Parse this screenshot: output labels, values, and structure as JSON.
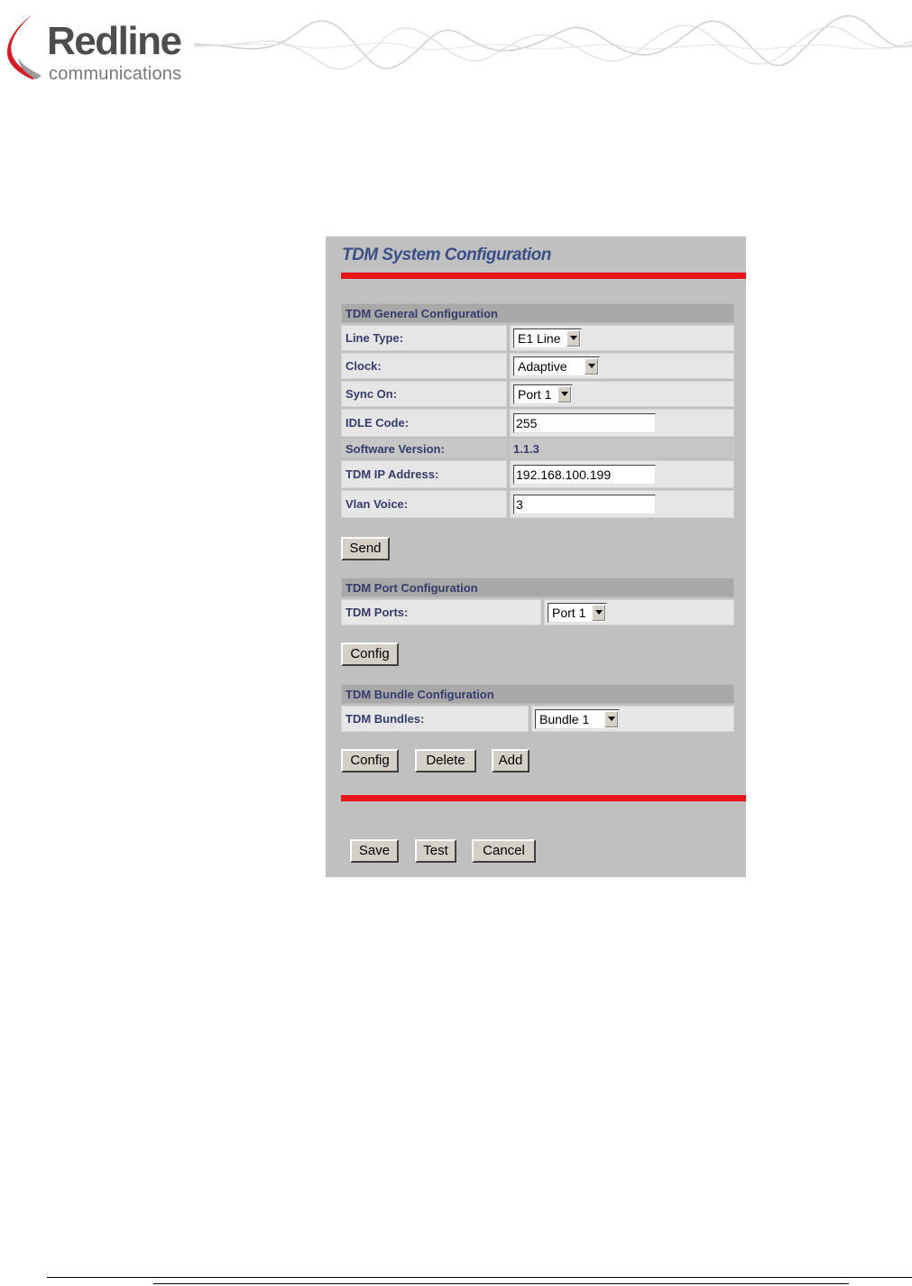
{
  "brand": {
    "name": "Redline",
    "tagline": "communications"
  },
  "panel": {
    "title": "TDM System Configuration",
    "general": {
      "header": "TDM General Configuration",
      "line_type": {
        "label": "Line Type:",
        "value": "E1 Line"
      },
      "clock": {
        "label": "Clock:",
        "value": "Adaptive"
      },
      "sync_on": {
        "label": "Sync On:",
        "value": "Port 1"
      },
      "idle_code": {
        "label": "IDLE Code:",
        "value": "255"
      },
      "software_version": {
        "label": "Software Version:",
        "value": "1.1.3"
      },
      "tdm_ip": {
        "label": "TDM IP Address:",
        "value": "192.168.100.199"
      },
      "vlan_voice": {
        "label": "Vlan Voice:",
        "value": "3"
      },
      "send_label": "Send"
    },
    "port": {
      "header": "TDM Port Configuration",
      "ports": {
        "label": "TDM Ports:",
        "value": "Port 1"
      },
      "config_label": "Config"
    },
    "bundle": {
      "header": "TDM Bundle Configuration",
      "bundles": {
        "label": "TDM Bundles:",
        "value": "Bundle 1"
      },
      "config_label": "Config",
      "delete_label": "Delete",
      "add_label": "Add"
    },
    "footer": {
      "save_label": "Save",
      "test_label": "Test",
      "cancel_label": "Cancel"
    }
  },
  "colors": {
    "accent_red": "#e8141b",
    "label_navy": "#353c6a",
    "panel_gray": "#c0c0c0"
  }
}
